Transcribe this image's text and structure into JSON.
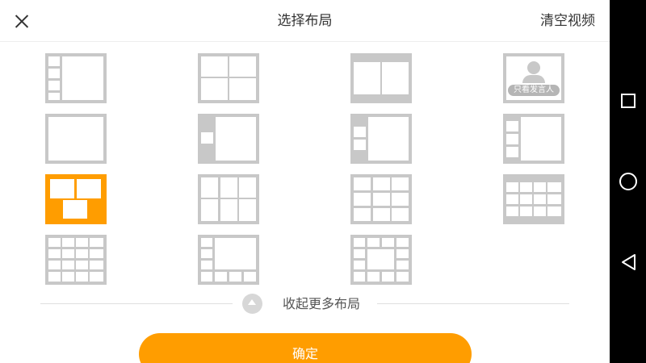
{
  "header": {
    "title": "选择布局",
    "clear_label": "清空视频"
  },
  "layouts": {
    "active_speaker_label": "只看发言人",
    "selected_index": 8
  },
  "collapse": {
    "label": "收起更多布局"
  },
  "footer": {
    "confirm_label": "确定"
  },
  "colors": {
    "accent": "#ff9d00",
    "tile_gray": "#c8c8c8"
  },
  "icons": {
    "close": "close-icon",
    "collapse": "chevron-up-icon",
    "nav_recent": "square-icon",
    "nav_home": "circle-icon",
    "nav_back": "triangle-back-icon"
  }
}
